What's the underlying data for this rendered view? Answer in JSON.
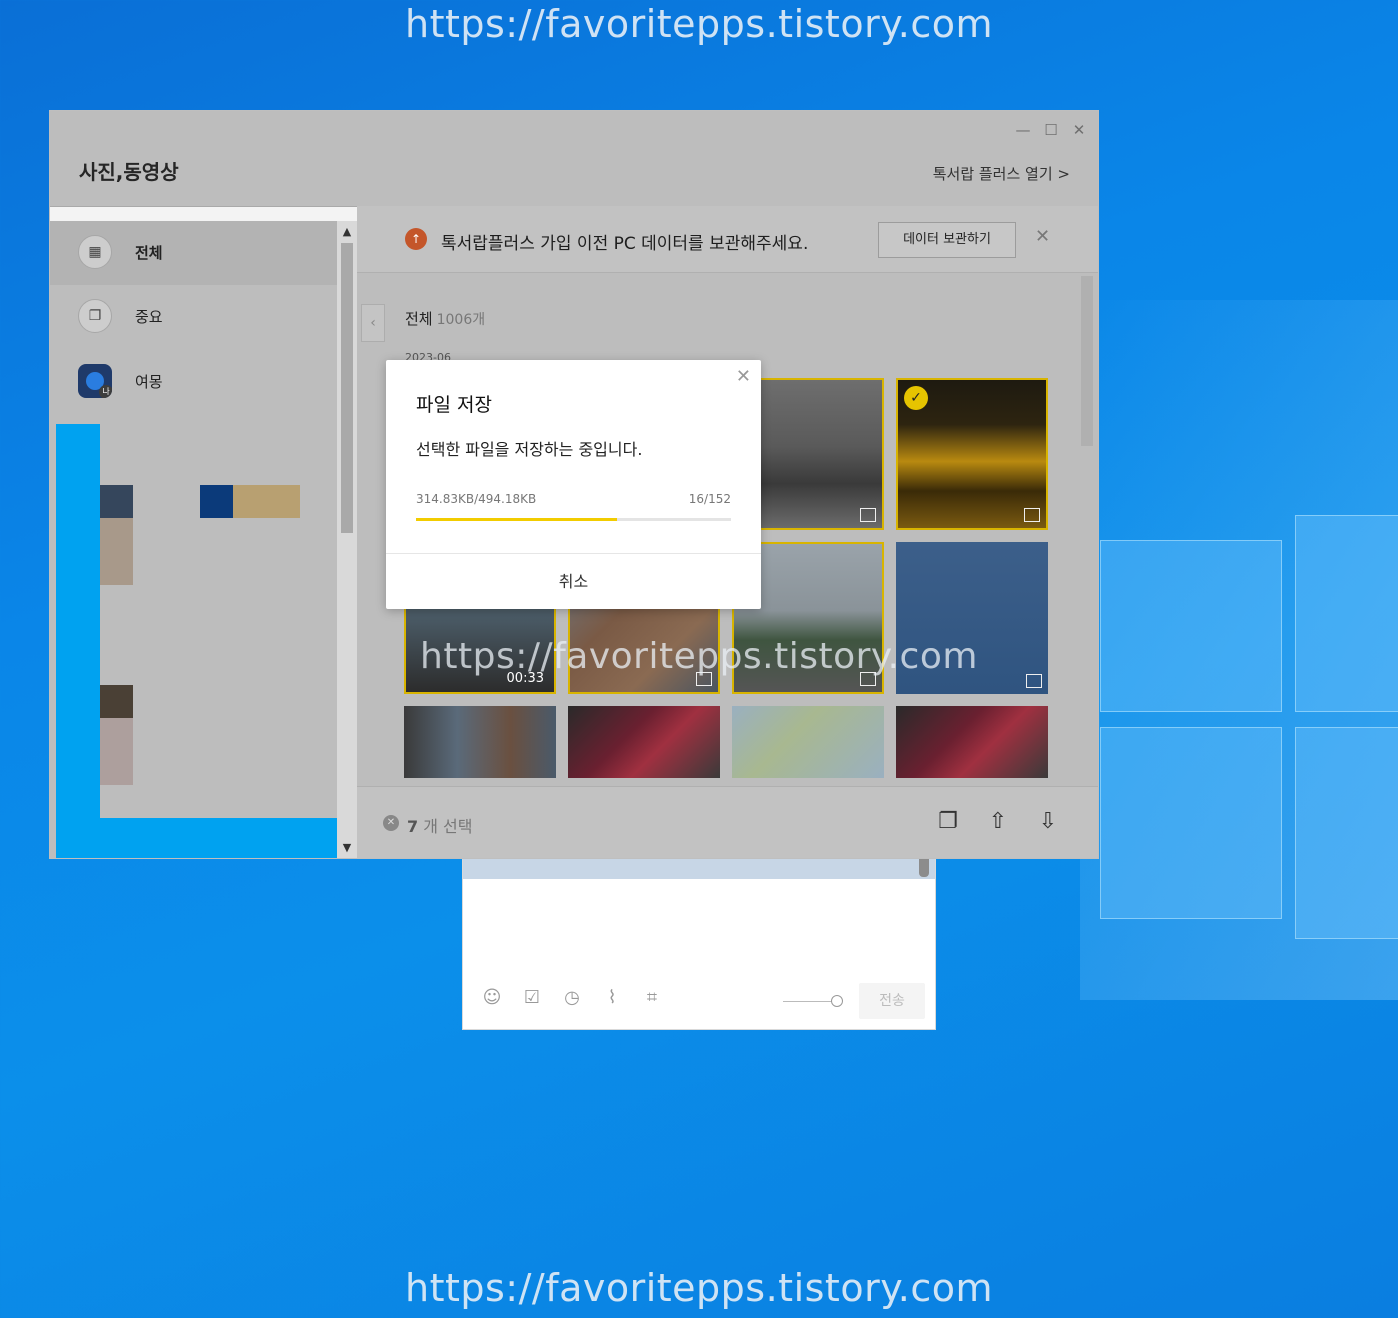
{
  "watermark": "https://favoritepps.tistory.com",
  "window": {
    "title": "사진,동영상",
    "open_plus": "톡서랍 플러스 열기 >",
    "controls": {
      "minimize": "—",
      "maximize": "☐",
      "close": "✕"
    }
  },
  "sidebar": {
    "items": [
      {
        "label": "전체",
        "icon": "grid-icon",
        "glyph": "▦"
      },
      {
        "label": "중요",
        "icon": "bookmark-icon",
        "glyph": "❐"
      },
      {
        "label": "여몽",
        "icon": "profile-avatar",
        "badge": "나"
      }
    ]
  },
  "banner": {
    "text": "톡서랍플러스 가입 이전 PC 데이터를 보관해주세요.",
    "button": "데이터 보관하기",
    "close": "✕"
  },
  "gallery": {
    "title": "전체",
    "count": "1006개",
    "date": "2023-06",
    "duration": "00:33"
  },
  "bottom_bar": {
    "count": "7",
    "label": "개 선택"
  },
  "dialog": {
    "title": "파일 저장",
    "message": "선택한 파일을 저장하는 중입니다.",
    "size": "314.83KB/494.18KB",
    "count": "16/152",
    "progress": 0.637,
    "cancel": "취소",
    "close": "✕"
  },
  "chat": {
    "send": "전송"
  },
  "colors": {
    "accent": "#f2cc00",
    "selected_border": "#d8b400",
    "banner_icon": "#c4562a"
  }
}
